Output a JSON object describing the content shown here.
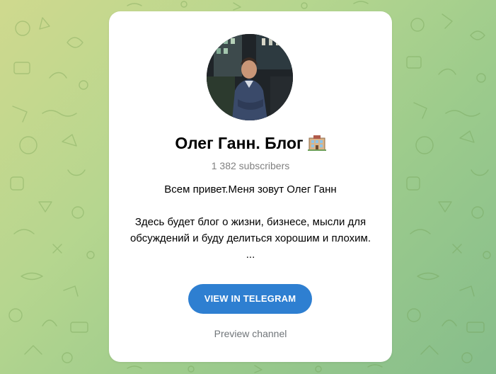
{
  "channel": {
    "title": "Олег Ганн. Блог",
    "title_emoji_icon": "hotel-building-icon",
    "subscribers": "1 382 subscribers",
    "description_line1": "Всем привет.Меня зовут Олег Ганн",
    "description_line2": "Здесь будет блог о жизни, бизнесе, мысли для обсуждений и буду делиться хорошим и плохим.",
    "description_more": "..."
  },
  "actions": {
    "view_button_label": "VIEW IN TELEGRAM",
    "preview_link_label": "Preview channel"
  },
  "colors": {
    "button": "#2e7fd1",
    "background_light": "#cfd98e",
    "background_dark": "#86bd8b",
    "subscribers_text": "#808080"
  }
}
